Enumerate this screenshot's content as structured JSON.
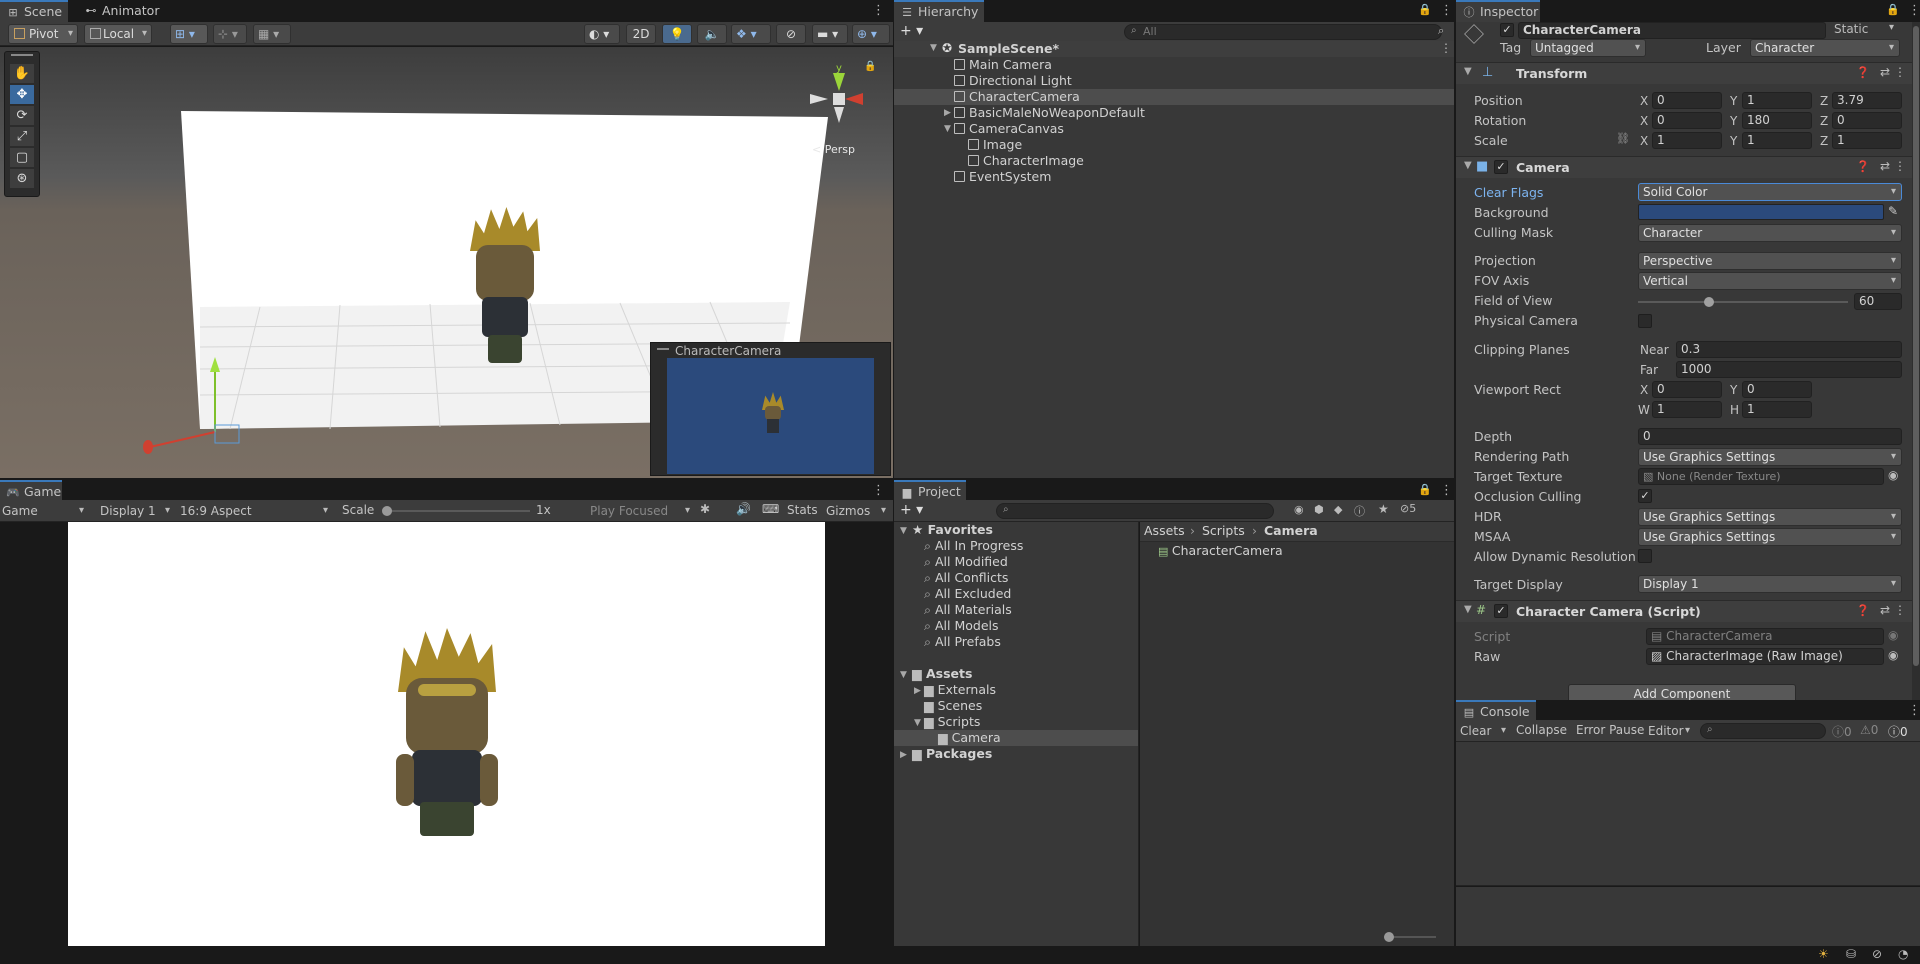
{
  "scene": {
    "tab_scene": "Scene",
    "tab_animator": "Animator",
    "pivot": "Pivot",
    "local": "Local",
    "btn_2d": "2D",
    "persp": "< Persp",
    "preview_title": "CharacterCamera"
  },
  "game": {
    "tab": "Game",
    "game_dd": "Game",
    "display": "Display 1",
    "aspect": "16:9 Aspect",
    "scale_label": "Scale",
    "scale_value": "1x",
    "play_focused": "Play Focused",
    "stats": "Stats",
    "gizmos": "Gizmos"
  },
  "hierarchy": {
    "tab": "Hierarchy",
    "search_placeholder": "All",
    "scene": "SampleScene*",
    "items": [
      "Main Camera",
      "Directional Light",
      "CharacterCamera",
      "BasicMaleNoWeaponDefault",
      "CameraCanvas",
      "Image",
      "CharacterImage",
      "EventSystem"
    ]
  },
  "project": {
    "tab": "Project",
    "layers_count": "5",
    "favorites": "Favorites",
    "fav_items": [
      "All In Progress",
      "All Modified",
      "All Conflicts",
      "All Excluded",
      "All Materials",
      "All Models",
      "All Prefabs"
    ],
    "assets": "Assets",
    "asset_items": [
      "Externals",
      "Scenes",
      "Scripts",
      "Camera"
    ],
    "packages": "Packages",
    "breadcrumb": [
      "Assets",
      "Scripts",
      "Camera"
    ],
    "files": [
      "CharacterCamera"
    ]
  },
  "inspector": {
    "tab": "Inspector",
    "object_name": "CharacterCamera",
    "static": "Static",
    "tag_label": "Tag",
    "tag_value": "Untagged",
    "layer_label": "Layer",
    "layer_value": "Character",
    "transform": {
      "title": "Transform",
      "position": "Position",
      "rotation": "Rotation",
      "scale": "Scale",
      "pos": [
        "0",
        "1",
        "3.79"
      ],
      "rot": [
        "0",
        "180",
        "0"
      ],
      "scl": [
        "1",
        "1",
        "1"
      ],
      "axes": [
        "X",
        "Y",
        "Z"
      ]
    },
    "camera": {
      "title": "Camera",
      "clear_flags": "Clear Flags",
      "clear_flags_value": "Solid Color",
      "background": "Background",
      "background_color": "#2b4a7c",
      "culling_mask": "Culling Mask",
      "culling_mask_value": "Character",
      "projection": "Projection",
      "projection_value": "Perspective",
      "fov_axis": "FOV Axis",
      "fov_axis_value": "Vertical",
      "fov": "Field of View",
      "fov_value": "60",
      "fov_fraction": 0.33,
      "physical": "Physical Camera",
      "clipping": "Clipping Planes",
      "near_label": "Near",
      "near": "0.3",
      "far_label": "Far",
      "far": "1000",
      "viewport": "Viewport Rect",
      "vp_x": "0",
      "vp_y": "0",
      "vp_w": "1",
      "vp_h": "1",
      "x": "X",
      "y": "Y",
      "w": "W",
      "h": "H",
      "depth": "Depth",
      "depth_value": "0",
      "rendering_path": "Rendering Path",
      "rendering_path_value": "Use Graphics Settings",
      "target_texture": "Target Texture",
      "target_texture_value": "None (Render Texture)",
      "occlusion": "Occlusion Culling",
      "hdr": "HDR",
      "hdr_value": "Use Graphics Settings",
      "msaa": "MSAA",
      "msaa_value": "Use Graphics Settings",
      "dynres": "Allow Dynamic Resolution",
      "target_display": "Target Display",
      "target_display_value": "Display 1"
    },
    "script": {
      "title": "Character Camera (Script)",
      "script_label": "Script",
      "script_value": "CharacterCamera",
      "raw_label": "Raw",
      "raw_value": "CharacterImage (Raw Image)"
    },
    "add_component": "Add Component"
  },
  "console": {
    "tab": "Console",
    "clear": "Clear",
    "collapse": "Collapse",
    "error_pause": "Error Pause",
    "editor": "Editor",
    "count_log": "0",
    "count_warn": "0",
    "count_err": "0"
  }
}
